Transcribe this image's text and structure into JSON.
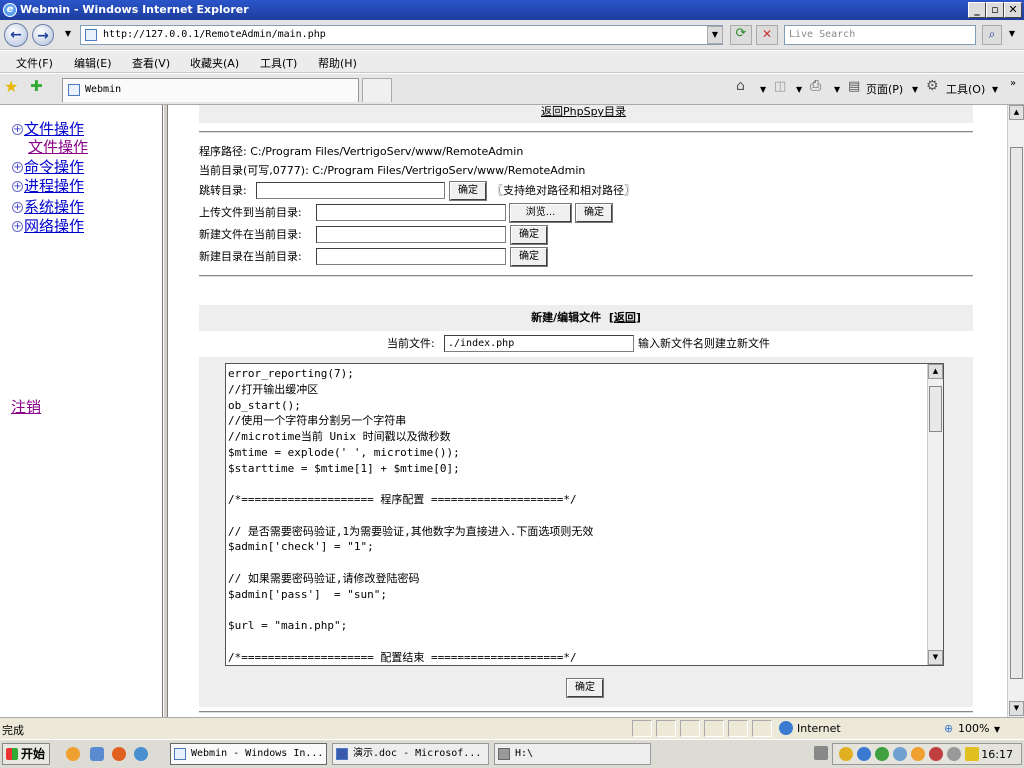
{
  "window": {
    "title": "Webmin - Windows Internet Explorer",
    "icon": "ie-icon"
  },
  "browser": {
    "address": "http://127.0.0.1/RemoteAdmin/main.php",
    "search_placeholder": "Live Search",
    "menu": [
      "文件(F)",
      "编辑(E)",
      "查看(V)",
      "收藏夹(A)",
      "工具(T)",
      "帮助(H)"
    ],
    "tab_title": "Webmin",
    "toolbar": {
      "page": "页面(P)",
      "tools": "工具(O)"
    }
  },
  "left_nav": {
    "items": [
      "文件操作",
      "命令操作",
      "进程操作",
      "系统操作",
      "网络操作"
    ],
    "sub_item": "文件操作",
    "logout": "注销"
  },
  "main": {
    "top_link": "返回PhpSpy目录",
    "program_path": "程序路径: C:/Program Files/VertrigoServ/www/RemoteAdmin",
    "current_dir": "当前目录(可写,0777): C:/Program Files/VertrigoServ/www/RemoteAdmin",
    "jump_label": "跳转目录:",
    "jump_hint": "〖支持绝对路径和相对路径〗",
    "upload_label": "上传文件到当前目录:",
    "browse_label": "浏览...",
    "newfile_label": "新建文件在当前目录:",
    "newdir_label": "新建目录在当前目录:",
    "ok_label": "确定",
    "edit_title": "新建/编辑文件",
    "edit_back": "返回",
    "current_file_label": "当前文件:",
    "current_file_value": "./index.php",
    "current_file_hint": "输入新文件名则建立新文件",
    "code": [
      "error_reporting(7);",
      "//打开输出缓冲区",
      "ob_start();",
      "//使用一个字符串分割另一个字符串",
      "//microtime当前 Unix 时间戳以及微秒数",
      "$mtime = explode(' ', microtime());",
      "$starttime = $mtime[1] + $mtime[0];",
      "",
      "/*==================== 程序配置 ====================*/",
      "",
      "// 是否需要密码验证,1为需要验证,其他数字为直接进入.下面选项则无效",
      "$admin['check'] = \"1\";",
      "",
      "// 如果需要密码验证,请修改登陆密码",
      "$admin['pass']  = \"sun\";",
      "",
      "$url = \"main.php\";",
      "",
      "/*==================== 配置结束 ====================*/"
    ]
  },
  "status": {
    "text": "完成",
    "zone": "Internet",
    "zoom": "100%"
  },
  "taskbar": {
    "start": "开始",
    "tasks": [
      "Webmin - Windows In...",
      "演示.doc - Microsof...",
      "H:\\"
    ],
    "clock": "16:17"
  }
}
